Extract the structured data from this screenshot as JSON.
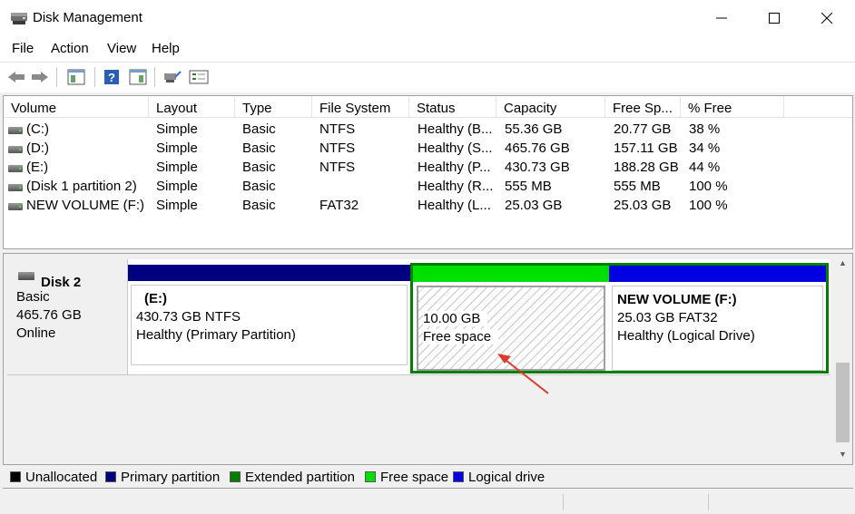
{
  "window": {
    "title": "Disk Management",
    "minimize_glyph": "─",
    "maximize_glyph": "☐",
    "close_glyph": "✕"
  },
  "menu": [
    "File",
    "Action",
    "View",
    "Help"
  ],
  "toolbar": {
    "icons": [
      "back-icon",
      "forward-icon",
      "console-tree-icon",
      "help-icon",
      "action-pane-icon",
      "connect-icon",
      "properties-icon"
    ]
  },
  "volume_list": {
    "columns": [
      "Volume",
      "Layout",
      "Type",
      "File System",
      "Status",
      "Capacity",
      "Free Sp...",
      "% Free"
    ],
    "rows": [
      {
        "volume": "(C:)",
        "layout": "Simple",
        "type": "Basic",
        "fs": "NTFS",
        "status": "Healthy (B...",
        "capacity": "55.36 GB",
        "free": "20.77 GB",
        "pct": "38 %"
      },
      {
        "volume": "(D:)",
        "layout": "Simple",
        "type": "Basic",
        "fs": "NTFS",
        "status": "Healthy (S...",
        "capacity": "465.76 GB",
        "free": "157.11 GB",
        "pct": "34 %"
      },
      {
        "volume": "(E:)",
        "layout": "Simple",
        "type": "Basic",
        "fs": "NTFS",
        "status": "Healthy (P...",
        "capacity": "430.73 GB",
        "free": "188.28 GB",
        "pct": "44 %"
      },
      {
        "volume": "(Disk 1 partition 2)",
        "layout": "Simple",
        "type": "Basic",
        "fs": "",
        "status": "Healthy (R...",
        "capacity": "555 MB",
        "free": "555 MB",
        "pct": "100 %"
      },
      {
        "volume": "NEW VOLUME (F:)",
        "layout": "Simple",
        "type": "Basic",
        "fs": "FAT32",
        "status": "Healthy (L...",
        "capacity": "25.03 GB",
        "free": "25.03 GB",
        "pct": "100 %"
      }
    ]
  },
  "disk": {
    "name": "Disk 2",
    "type": "Basic",
    "size": "465.76 GB",
    "state": "Online",
    "partitions": [
      {
        "title": "(E:)",
        "size_fs": "430.73 GB NTFS",
        "status": "Healthy (Primary Partition)",
        "bar_color": "#000080"
      },
      {
        "title": "",
        "size_fs": "10.00 GB",
        "status": "Free space",
        "bar_color": "#00e000"
      },
      {
        "title": "NEW VOLUME  (F:)",
        "size_fs": "25.03 GB FAT32",
        "status": "Healthy (Logical Drive)",
        "bar_color": "#0000e0"
      }
    ],
    "extended_color": "#008000"
  },
  "legend": [
    {
      "label": "Unallocated",
      "color": "#000000"
    },
    {
      "label": "Primary partition",
      "color": "#000080"
    },
    {
      "label": "Extended partition",
      "color": "#008000"
    },
    {
      "label": "Free space",
      "color": "#00e000"
    },
    {
      "label": "Logical drive",
      "color": "#0000e0"
    }
  ],
  "annotation": {
    "color": "#e0392b"
  }
}
